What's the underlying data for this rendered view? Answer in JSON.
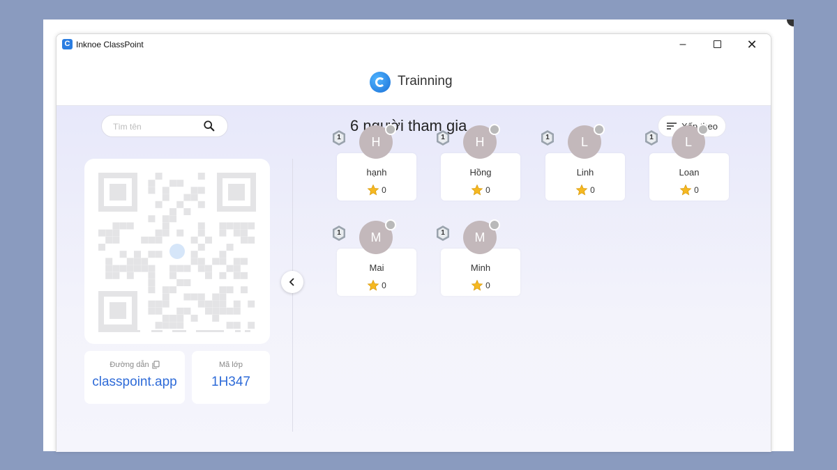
{
  "window": {
    "app_title": "Inknoe ClassPoint",
    "controls": {
      "minimize": "–",
      "close": "✕"
    }
  },
  "header": {
    "session_name": "Trainning"
  },
  "search": {
    "placeholder": "Tìm tên"
  },
  "participants_count_label": "6 người tham gia",
  "sort_button": {
    "label": "Xếp theo"
  },
  "join_info": {
    "link_label": "Đường dẫn",
    "link_value": "classpoint.app",
    "code_label": "Mã lớp",
    "code_value": "1H347"
  },
  "participants": [
    {
      "initial": "H",
      "name": "hạnh",
      "level": "1",
      "stars": "0"
    },
    {
      "initial": "H",
      "name": "Hồng",
      "level": "1",
      "stars": "0"
    },
    {
      "initial": "L",
      "name": "Linh",
      "level": "1",
      "stars": "0"
    },
    {
      "initial": "L",
      "name": "Loan",
      "level": "1",
      "stars": "0"
    },
    {
      "initial": "M",
      "name": "Mai",
      "level": "1",
      "stars": "0"
    },
    {
      "initial": "M",
      "name": "Minh",
      "level": "1",
      "stars": "0"
    }
  ],
  "colors": {
    "background": "#8a9bbf",
    "accent_blue": "#2e6bd8",
    "avatar": "#c3b8bb",
    "star": "#f5b821"
  },
  "icons": [
    "search-icon",
    "sort-icon",
    "copy-icon",
    "chevron-left-icon",
    "star-icon",
    "level-badge-icon",
    "qr-code"
  ]
}
